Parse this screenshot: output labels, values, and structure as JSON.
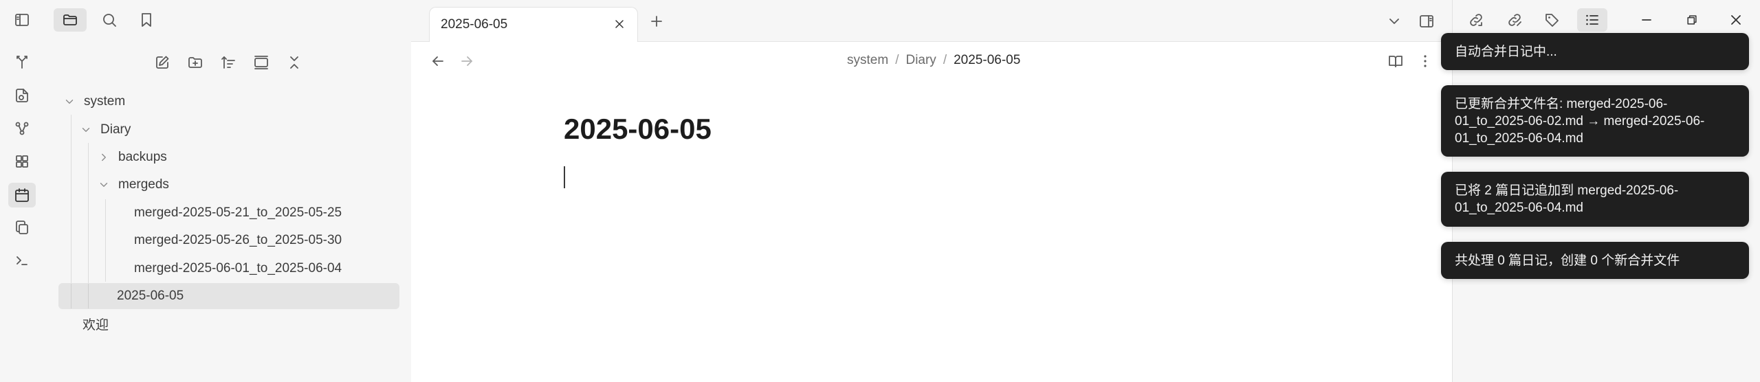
{
  "ribbon": {
    "top_icons": [
      "sidebar-toggle-icon",
      "folder-icon",
      "search-icon",
      "bookmark-icon"
    ],
    "icons": [
      "merge-icon",
      "file-sync-icon",
      "graph-icon",
      "plugins-icon",
      "calendar-icon",
      "copy-icon",
      "terminal-icon"
    ]
  },
  "file_explorer": {
    "toolbar": [
      "new-note-icon",
      "new-folder-icon",
      "sort-icon",
      "auto-reveal-icon",
      "collapse-all-icon"
    ],
    "tree": {
      "system": "system",
      "diary": "Diary",
      "backups": "backups",
      "mergeds": "mergeds",
      "merged_1": "merged-2025-05-21_to_2025-05-25",
      "merged_2": "merged-2025-05-26_to_2025-05-30",
      "merged_3": "merged-2025-06-01_to_2025-06-04",
      "current": "2025-06-05",
      "welcome": "欢迎"
    }
  },
  "tabs": {
    "active_title": "2025-06-05"
  },
  "breadcrumb": {
    "part1": "system",
    "sep1": "/",
    "part2": "Diary",
    "sep2": "/",
    "part3": "2025-06-05"
  },
  "document": {
    "title": "2025-06-05"
  },
  "notices": {
    "n1": "自动合并日记中...",
    "n2": "已更新合并文件名: merged-2025-06-\n01_to_2025-06-02.md → merged-2025-06-\n01_to_2025-06-04.md",
    "n3": "已将 2 篇日记追加到 merged-2025-06-\n01_to_2025-06-04.md",
    "n4": "共处理 0 篇日记，创建 0 个新合并文件"
  },
  "colors": {
    "notice_bg": "#1f1f1f",
    "sidebar_bg": "#f6f6f6",
    "selected_bg": "#e4e4e4"
  }
}
